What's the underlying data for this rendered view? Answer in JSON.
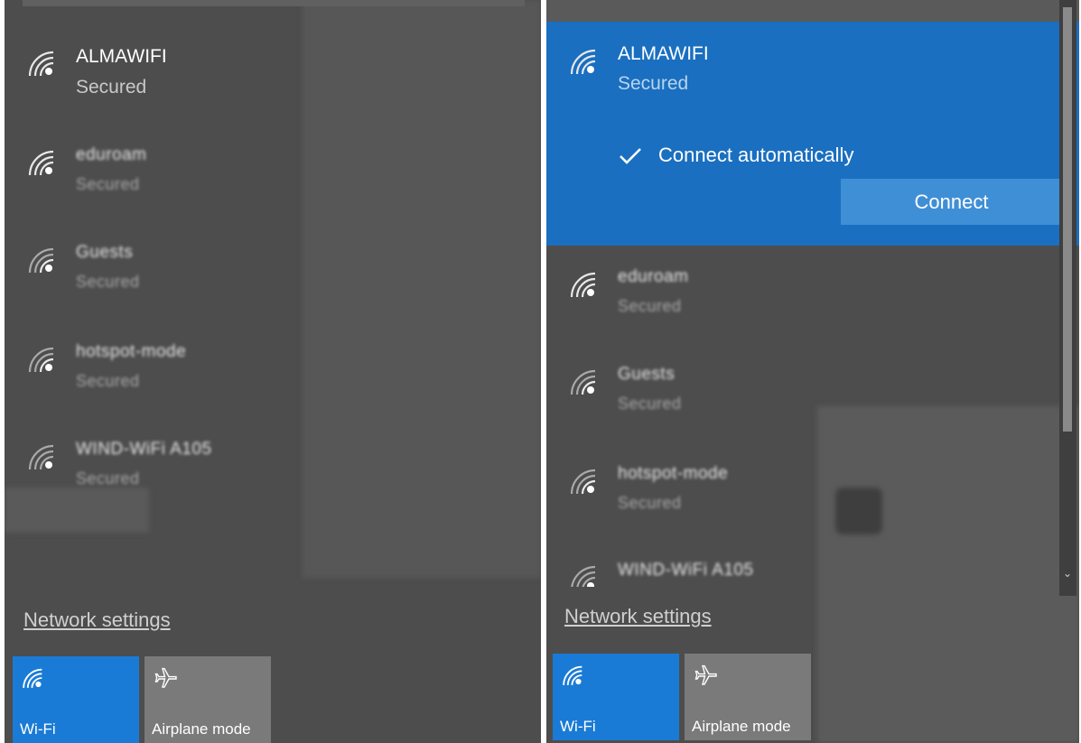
{
  "left_panel": {
    "networks": [
      {
        "ssid": "ALMAWIFI",
        "status": "Secured"
      },
      {
        "ssid": "eduroam",
        "status": "Secured"
      },
      {
        "ssid": "Guests",
        "status": "Secured"
      },
      {
        "ssid": "hotspot-mode",
        "status": "Secured"
      },
      {
        "ssid": "WIND-WiFi A105",
        "status": "Secured"
      }
    ],
    "network_settings": "Network settings",
    "tiles": {
      "wifi": "Wi-Fi",
      "airplane": "Airplane mode"
    }
  },
  "right_panel": {
    "selected": {
      "ssid": "ALMAWIFI",
      "status": "Secured",
      "connect_automatically": "Connect automatically",
      "connect_button": "Connect"
    },
    "networks": [
      {
        "ssid": "eduroam",
        "status": "Secured"
      },
      {
        "ssid": "Guests",
        "status": "Secured"
      },
      {
        "ssid": "hotspot-mode",
        "status": "Secured"
      },
      {
        "ssid": "WIND-WiFi A105",
        "status": ""
      }
    ],
    "network_settings": "Network settings",
    "tiles": {
      "wifi": "Wi-Fi",
      "airplane": "Airplane mode"
    },
    "scroll_down_glyph": "⌄"
  },
  "icons": {
    "network": "wifi-signal-icon",
    "check": "checkmark-icon",
    "airplane": "airplane-icon"
  },
  "colors": {
    "panel": "#4d4d4d",
    "accent": "#1a6fc0",
    "tile_active": "#1a7bd6",
    "connect_button": "#3f8fd6"
  }
}
